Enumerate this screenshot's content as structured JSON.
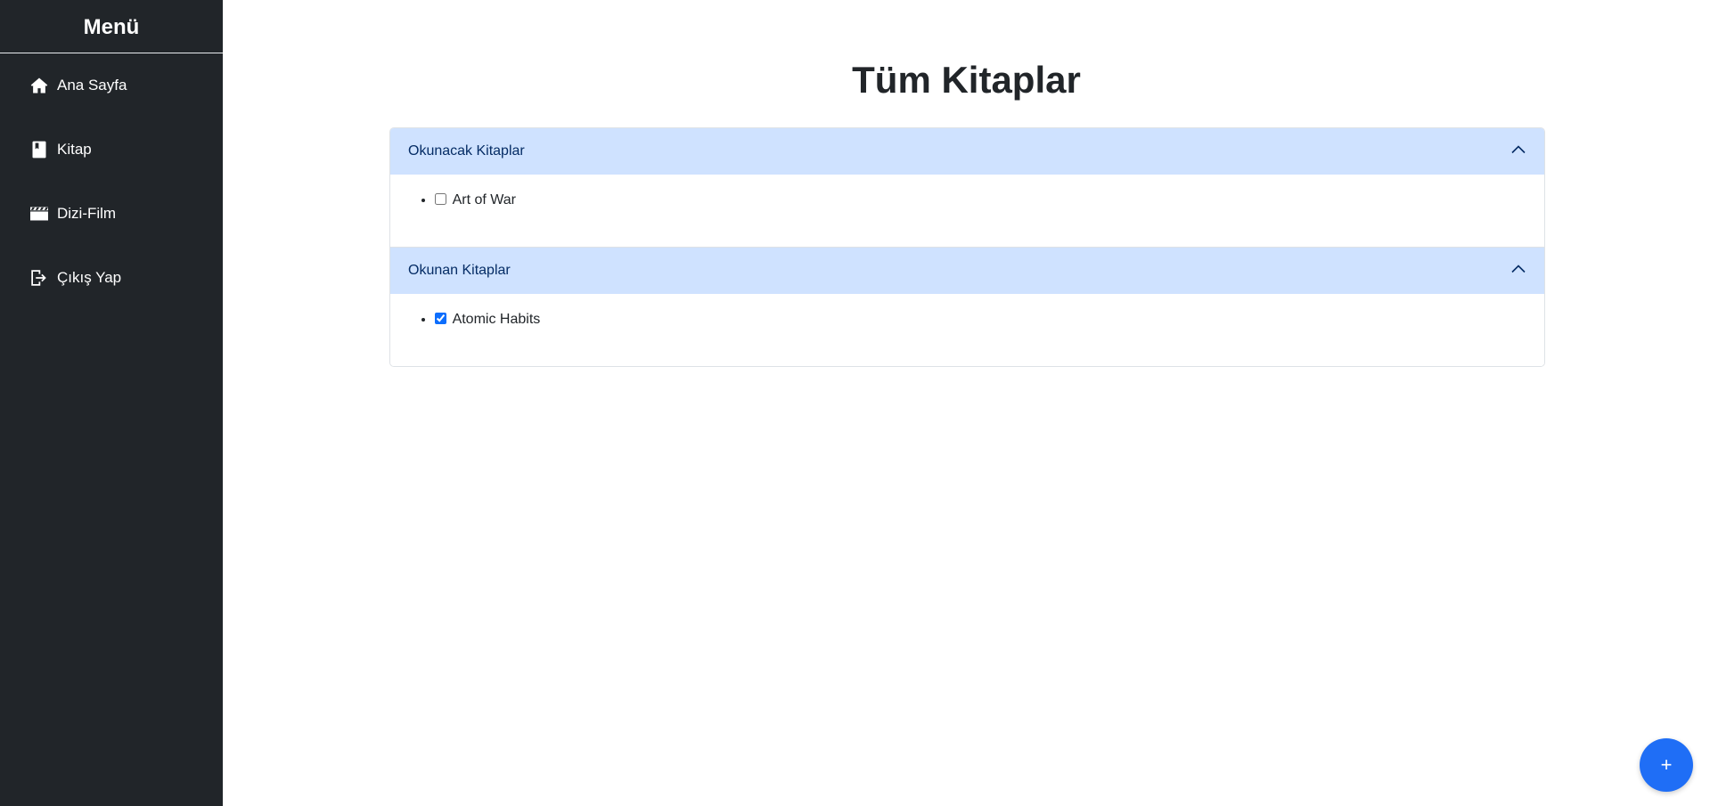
{
  "sidebar": {
    "title": "Menü",
    "items": [
      {
        "label": "Ana Sayfa",
        "icon": "home-icon"
      },
      {
        "label": "Kitap",
        "icon": "book-icon"
      },
      {
        "label": "Dizi-Film",
        "icon": "film-icon"
      },
      {
        "label": "Çıkış Yap",
        "icon": "logout-icon"
      }
    ]
  },
  "main": {
    "title": "Tüm Kitaplar",
    "sections": [
      {
        "header": "Okunacak Kitaplar",
        "expanded": true,
        "books": [
          {
            "title": "Art of War",
            "checked": false
          }
        ]
      },
      {
        "header": "Okunan Kitaplar",
        "expanded": true,
        "books": [
          {
            "title": "Atomic Habits",
            "checked": true
          }
        ]
      }
    ]
  },
  "fab": {
    "label": "+"
  },
  "colors": {
    "sidebar_bg": "#212529",
    "accordion_header_bg": "#cfe2ff",
    "accent": "#0d6efd",
    "fab_bg": "#1f6ef6"
  }
}
